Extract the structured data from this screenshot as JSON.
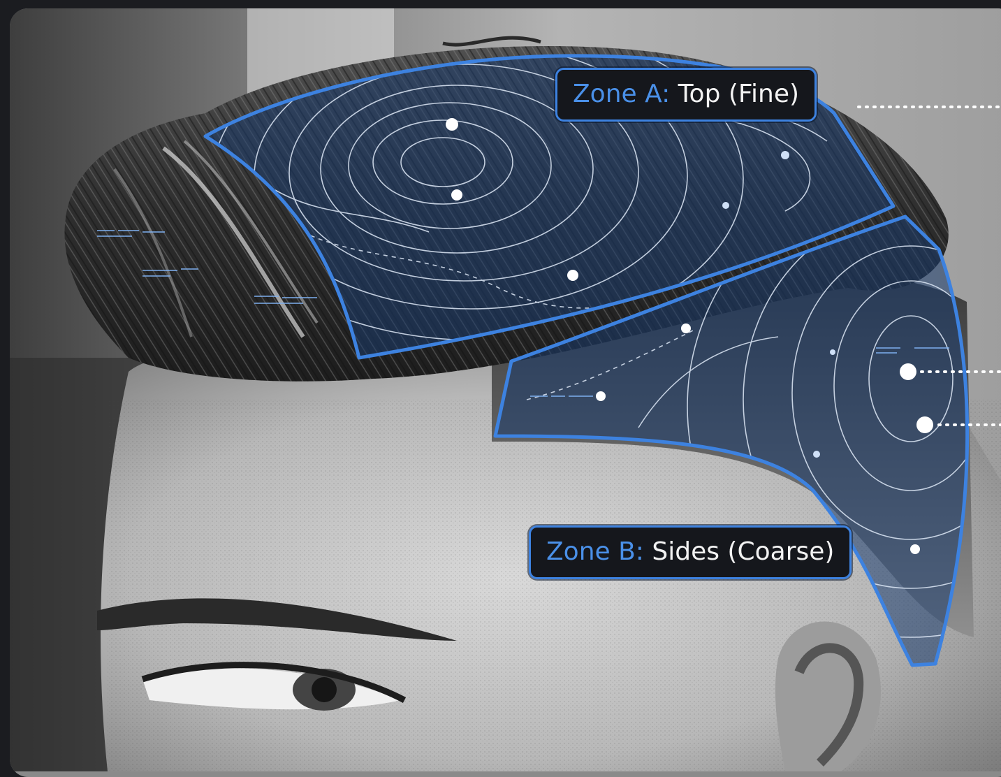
{
  "zones": [
    {
      "id": "Zone A:",
      "desc": "Top (Fine)"
    },
    {
      "id": "Zone B:",
      "desc": "Sides (Coarse)"
    }
  ],
  "colors": {
    "accent": "#3d82e0",
    "label_background": "#15171c",
    "label_text": "#f2f2f2",
    "overlay_tint": "#1c3d6e"
  },
  "icons": [
    "contour-map-overlay",
    "data-point-marker",
    "leader-dotted-line"
  ]
}
